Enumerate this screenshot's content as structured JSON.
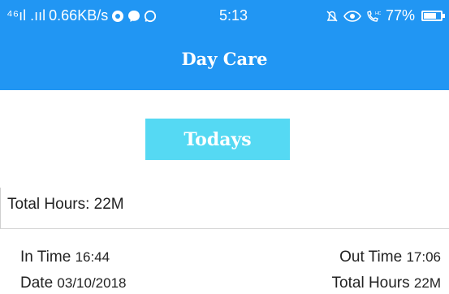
{
  "status_bar": {
    "network": "⁴⁶ıl .ııl",
    "speed": "0.66KB/s",
    "app_icons": [
      "chrome-icon",
      "messenger-icon",
      "whatsapp-icon"
    ],
    "time": "5:13",
    "right_icons": [
      "alarm-icon",
      "eye-icon",
      "hd-call-icon"
    ],
    "battery_percent": "77%",
    "battery_level": 0.77
  },
  "app_bar": {
    "title": "Day Care"
  },
  "todays_button": {
    "label": "Todays"
  },
  "summary": {
    "text": "Total Hours: 22M"
  },
  "details": {
    "in_time_label": "In Time",
    "in_time_value": "16:44",
    "date_label": "Date",
    "date_value": "03/10/2018",
    "out_time_label": "Out Time",
    "out_time_value": "17:06",
    "total_hours_label": "Total Hours",
    "total_hours_value": "22M"
  },
  "colors": {
    "primary": "#2196f3",
    "button": "#55d9f3",
    "text": "#212121"
  }
}
